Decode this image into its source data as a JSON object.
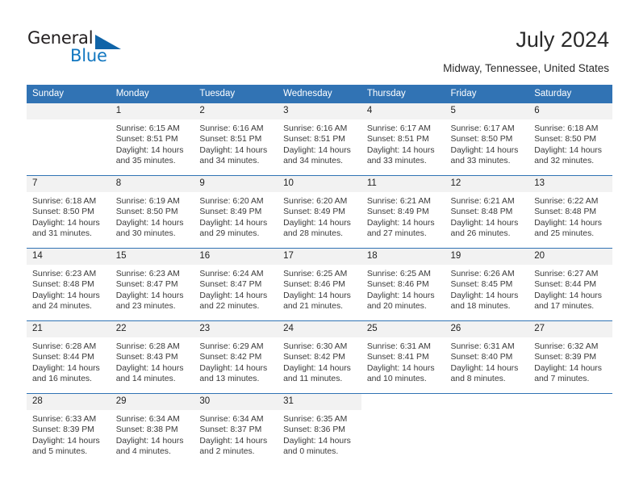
{
  "brand": {
    "name_dark": "General",
    "name_light": "Blue",
    "accent_color": "#1064a8",
    "logo_icon": "triangle-icon"
  },
  "header": {
    "title": "July 2024",
    "location": "Midway, Tennessee, United States"
  },
  "calendar": {
    "header_color": "#3173b4",
    "daynum_band_color": "#f2f2f2",
    "weekday_headers": [
      "Sunday",
      "Monday",
      "Tuesday",
      "Wednesday",
      "Thursday",
      "Friday",
      "Saturday"
    ],
    "weeks": [
      [
        {
          "day": "",
          "lines": []
        },
        {
          "day": "1",
          "lines": [
            "Sunrise: 6:15 AM",
            "Sunset: 8:51 PM",
            "Daylight: 14 hours",
            "and 35 minutes."
          ]
        },
        {
          "day": "2",
          "lines": [
            "Sunrise: 6:16 AM",
            "Sunset: 8:51 PM",
            "Daylight: 14 hours",
            "and 34 minutes."
          ]
        },
        {
          "day": "3",
          "lines": [
            "Sunrise: 6:16 AM",
            "Sunset: 8:51 PM",
            "Daylight: 14 hours",
            "and 34 minutes."
          ]
        },
        {
          "day": "4",
          "lines": [
            "Sunrise: 6:17 AM",
            "Sunset: 8:51 PM",
            "Daylight: 14 hours",
            "and 33 minutes."
          ]
        },
        {
          "day": "5",
          "lines": [
            "Sunrise: 6:17 AM",
            "Sunset: 8:50 PM",
            "Daylight: 14 hours",
            "and 33 minutes."
          ]
        },
        {
          "day": "6",
          "lines": [
            "Sunrise: 6:18 AM",
            "Sunset: 8:50 PM",
            "Daylight: 14 hours",
            "and 32 minutes."
          ]
        }
      ],
      [
        {
          "day": "7",
          "lines": [
            "Sunrise: 6:18 AM",
            "Sunset: 8:50 PM",
            "Daylight: 14 hours",
            "and 31 minutes."
          ]
        },
        {
          "day": "8",
          "lines": [
            "Sunrise: 6:19 AM",
            "Sunset: 8:50 PM",
            "Daylight: 14 hours",
            "and 30 minutes."
          ]
        },
        {
          "day": "9",
          "lines": [
            "Sunrise: 6:20 AM",
            "Sunset: 8:49 PM",
            "Daylight: 14 hours",
            "and 29 minutes."
          ]
        },
        {
          "day": "10",
          "lines": [
            "Sunrise: 6:20 AM",
            "Sunset: 8:49 PM",
            "Daylight: 14 hours",
            "and 28 minutes."
          ]
        },
        {
          "day": "11",
          "lines": [
            "Sunrise: 6:21 AM",
            "Sunset: 8:49 PM",
            "Daylight: 14 hours",
            "and 27 minutes."
          ]
        },
        {
          "day": "12",
          "lines": [
            "Sunrise: 6:21 AM",
            "Sunset: 8:48 PM",
            "Daylight: 14 hours",
            "and 26 minutes."
          ]
        },
        {
          "day": "13",
          "lines": [
            "Sunrise: 6:22 AM",
            "Sunset: 8:48 PM",
            "Daylight: 14 hours",
            "and 25 minutes."
          ]
        }
      ],
      [
        {
          "day": "14",
          "lines": [
            "Sunrise: 6:23 AM",
            "Sunset: 8:48 PM",
            "Daylight: 14 hours",
            "and 24 minutes."
          ]
        },
        {
          "day": "15",
          "lines": [
            "Sunrise: 6:23 AM",
            "Sunset: 8:47 PM",
            "Daylight: 14 hours",
            "and 23 minutes."
          ]
        },
        {
          "day": "16",
          "lines": [
            "Sunrise: 6:24 AM",
            "Sunset: 8:47 PM",
            "Daylight: 14 hours",
            "and 22 minutes."
          ]
        },
        {
          "day": "17",
          "lines": [
            "Sunrise: 6:25 AM",
            "Sunset: 8:46 PM",
            "Daylight: 14 hours",
            "and 21 minutes."
          ]
        },
        {
          "day": "18",
          "lines": [
            "Sunrise: 6:25 AM",
            "Sunset: 8:46 PM",
            "Daylight: 14 hours",
            "and 20 minutes."
          ]
        },
        {
          "day": "19",
          "lines": [
            "Sunrise: 6:26 AM",
            "Sunset: 8:45 PM",
            "Daylight: 14 hours",
            "and 18 minutes."
          ]
        },
        {
          "day": "20",
          "lines": [
            "Sunrise: 6:27 AM",
            "Sunset: 8:44 PM",
            "Daylight: 14 hours",
            "and 17 minutes."
          ]
        }
      ],
      [
        {
          "day": "21",
          "lines": [
            "Sunrise: 6:28 AM",
            "Sunset: 8:44 PM",
            "Daylight: 14 hours",
            "and 16 minutes."
          ]
        },
        {
          "day": "22",
          "lines": [
            "Sunrise: 6:28 AM",
            "Sunset: 8:43 PM",
            "Daylight: 14 hours",
            "and 14 minutes."
          ]
        },
        {
          "day": "23",
          "lines": [
            "Sunrise: 6:29 AM",
            "Sunset: 8:42 PM",
            "Daylight: 14 hours",
            "and 13 minutes."
          ]
        },
        {
          "day": "24",
          "lines": [
            "Sunrise: 6:30 AM",
            "Sunset: 8:42 PM",
            "Daylight: 14 hours",
            "and 11 minutes."
          ]
        },
        {
          "day": "25",
          "lines": [
            "Sunrise: 6:31 AM",
            "Sunset: 8:41 PM",
            "Daylight: 14 hours",
            "and 10 minutes."
          ]
        },
        {
          "day": "26",
          "lines": [
            "Sunrise: 6:31 AM",
            "Sunset: 8:40 PM",
            "Daylight: 14 hours",
            "and 8 minutes."
          ]
        },
        {
          "day": "27",
          "lines": [
            "Sunrise: 6:32 AM",
            "Sunset: 8:39 PM",
            "Daylight: 14 hours",
            "and 7 minutes."
          ]
        }
      ],
      [
        {
          "day": "28",
          "lines": [
            "Sunrise: 6:33 AM",
            "Sunset: 8:39 PM",
            "Daylight: 14 hours",
            "and 5 minutes."
          ]
        },
        {
          "day": "29",
          "lines": [
            "Sunrise: 6:34 AM",
            "Sunset: 8:38 PM",
            "Daylight: 14 hours",
            "and 4 minutes."
          ]
        },
        {
          "day": "30",
          "lines": [
            "Sunrise: 6:34 AM",
            "Sunset: 8:37 PM",
            "Daylight: 14 hours",
            "and 2 minutes."
          ]
        },
        {
          "day": "31",
          "lines": [
            "Sunrise: 6:35 AM",
            "Sunset: 8:36 PM",
            "Daylight: 14 hours",
            "and 0 minutes."
          ]
        },
        {
          "day": "",
          "lines": []
        },
        {
          "day": "",
          "lines": []
        },
        {
          "day": "",
          "lines": []
        }
      ]
    ]
  }
}
